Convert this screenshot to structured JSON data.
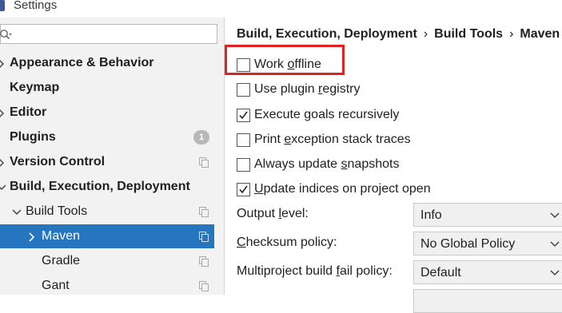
{
  "window": {
    "title": "Settings"
  },
  "sidebar": {
    "search": {
      "placeholder": ""
    },
    "items": [
      {
        "label": "Appearance & Behavior",
        "expand": "collapsed",
        "badge": ""
      },
      {
        "label": "Keymap",
        "expand": "",
        "badge": ""
      },
      {
        "label": "Editor",
        "expand": "collapsed",
        "badge": ""
      },
      {
        "label": "Plugins",
        "expand": "",
        "badge": "1"
      },
      {
        "label": "Version Control",
        "expand": "collapsed",
        "badge": ""
      },
      {
        "label": "Build, Execution, Deployment",
        "expand": "expanded",
        "badge": ""
      },
      {
        "label": "Build Tools",
        "expand": "expanded",
        "badge": ""
      },
      {
        "label": "Maven",
        "expand": "collapsed",
        "badge": "",
        "selected": true
      },
      {
        "label": "Gradle",
        "expand": "",
        "badge": ""
      },
      {
        "label": "Gant",
        "expand": "",
        "badge": ""
      }
    ]
  },
  "breadcrumb": {
    "parts": [
      "Build, Execution, Deployment",
      "Build Tools",
      "Maven"
    ],
    "separator": "›"
  },
  "options": [
    {
      "label_pre": "Work ",
      "mnemonic": "o",
      "label_post": "ffline",
      "checked": false
    },
    {
      "label_pre": "Use plugin ",
      "mnemonic": "r",
      "label_post": "egistry",
      "checked": false
    },
    {
      "label_pre": "Execute ",
      "mnemonic": "g",
      "label_post": "oals recursively",
      "checked": true
    },
    {
      "label_pre": "Print ",
      "mnemonic": "e",
      "label_post": "xception stack traces",
      "checked": false
    },
    {
      "label_pre": "Always update ",
      "mnemonic": "s",
      "label_post": "napshots",
      "checked": false
    },
    {
      "label_pre": "",
      "mnemonic": "U",
      "label_post": "pdate indices on project open",
      "checked": true
    }
  ],
  "fields": [
    {
      "label_pre": "Output ",
      "mnemonic": "l",
      "label_post": "evel:",
      "value": "Info"
    },
    {
      "label_pre": "",
      "mnemonic": "C",
      "label_post": "hecksum policy:",
      "value": "No Global Policy"
    },
    {
      "label_pre": "Multiproject build ",
      "mnemonic": "f",
      "label_post": "ail policy:",
      "value": "Default"
    }
  ],
  "colors": {
    "selection": "#2675bf",
    "highlight_box": "#e52020"
  }
}
